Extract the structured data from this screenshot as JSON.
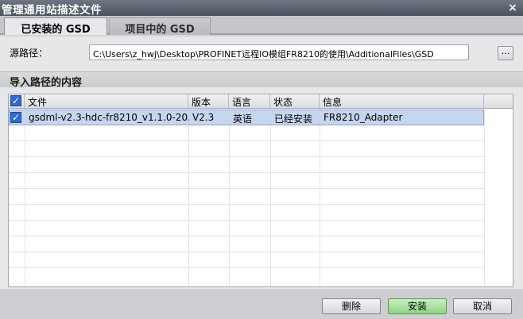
{
  "window": {
    "title": "管理通用站描述文件",
    "close_glyph": "×"
  },
  "tabs": [
    {
      "label": "已安装的 GSD",
      "active": true
    },
    {
      "label": "项目中的 GSD",
      "active": false
    }
  ],
  "source": {
    "label": "源路径：",
    "path": "C:\\Users\\z_hwj\\Desktop\\PROFINET远程IO模组FR8210的使用\\AdditionalFiles\\GSD",
    "browse_label": "..."
  },
  "section": {
    "title": "导入路径的内容"
  },
  "table": {
    "columns": [
      "文件",
      "版本",
      "语言",
      "状态",
      "信息"
    ],
    "rows": [
      {
        "checked": true,
        "file": "gsdml-v2.3-hdc-fr8210_v1.1.0-20...",
        "version": "V2.3",
        "language": "英语",
        "status": "已经安装",
        "info": "FR8210_Adapter"
      }
    ]
  },
  "buttons": {
    "delete": "删除",
    "install": "安装",
    "cancel": "取消"
  },
  "colors": {
    "titlebar": "#4a535e",
    "selection": "#c7d6ef",
    "checkbox": "#2d6ad6",
    "install_button": "#8fd585"
  },
  "icons": {
    "checkbox": "checkmark-icon",
    "close": "close-icon"
  }
}
